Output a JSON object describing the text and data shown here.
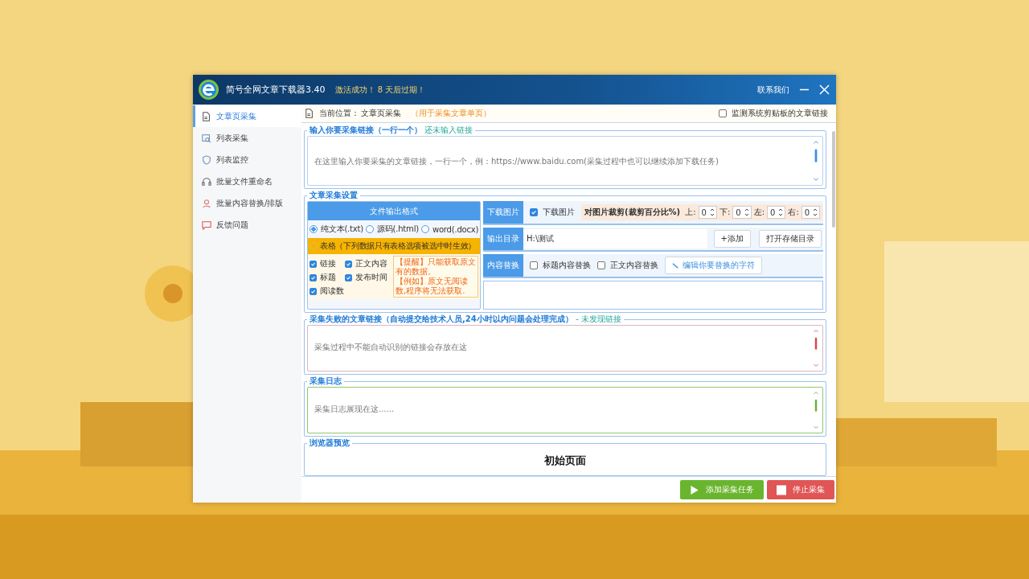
{
  "app": {
    "title": "简号全网文章下载器3.40",
    "activation": "激活成功！ 8 天后过期！",
    "contact": "联系我们"
  },
  "sidebar": {
    "items": [
      {
        "label": "文章页采集",
        "selected": true
      },
      {
        "label": "列表采集",
        "selected": false
      },
      {
        "label": "列表监控",
        "selected": false
      },
      {
        "label": "批量文件重命名",
        "selected": false
      },
      {
        "label": "批量内容替换/排版",
        "selected": false
      },
      {
        "label": "反馈问题",
        "selected": false
      }
    ]
  },
  "breadcrumb": {
    "label": "当前位置：",
    "page": "文章页采集",
    "hint": "（用于采集文章单页）"
  },
  "clipboard_monitor": {
    "label": "监测系统剪贴板的文章链接",
    "checked": false
  },
  "link_input": {
    "title": "输入你要采集链接（一行一个）",
    "status": "还未输入链接",
    "placeholder": "在这里输入你要采集的文章链接，一行一个，例：https://www.baidu.com(采集过程中也可以继续添加下载任务)"
  },
  "settings": {
    "title": "文章采集设置",
    "format": {
      "title": "文件输出格式",
      "options": [
        {
          "label": "纯文本(.txt)",
          "selected": true
        },
        {
          "label": "源码(.html)",
          "selected": false
        },
        {
          "label": "word(.docx)",
          "selected": false
        }
      ],
      "table_option": {
        "label": "表格（下列数据只有表格选项被选中时生效）",
        "selected": false
      },
      "fields": [
        {
          "label": "链接",
          "checked": true
        },
        {
          "label": "正文内容",
          "checked": true
        },
        {
          "label": "标题",
          "checked": true
        },
        {
          "label": "发布时间",
          "checked": true
        },
        {
          "label": "阅读数",
          "checked": true
        }
      ],
      "notes": [
        "【提醒】只能获取原文有的数据。",
        "【例如】原文无阅读数,程序将无法获取."
      ]
    },
    "images": {
      "label": "下载图片",
      "checkbox": {
        "label": "下载图片",
        "checked": true
      },
      "crop_label": "对图片裁剪(裁剪百分比%)",
      "crops": [
        {
          "label": "上:",
          "value": "0"
        },
        {
          "label": "下:",
          "value": "0"
        },
        {
          "label": "左:",
          "value": "0"
        },
        {
          "label": "右:",
          "value": "0"
        }
      ]
    },
    "output": {
      "label": "输出目录",
      "path": "H:\\测试",
      "add_button": "+添加",
      "open_button": "打开存储目录"
    },
    "replace": {
      "label": "内容替换",
      "options": [
        {
          "label": "标题内容替换",
          "checked": false
        },
        {
          "label": "正文内容替换",
          "checked": false
        }
      ],
      "edit_button": "编辑你要替换的字符"
    }
  },
  "failed_links": {
    "title": "采集失败的文章链接（自动提交给技术人员,24小时以内问题会处理完成）",
    "status": "- 未发现链接",
    "placeholder": "采集过程中不能自动识别的链接会存放在这"
  },
  "log": {
    "title": "采集日志",
    "placeholder": "采集日志展现在这......"
  },
  "preview": {
    "title": "浏览器预览",
    "heading": "初始页面"
  },
  "actions": {
    "add": "添加采集任务",
    "stop": "停止采集"
  }
}
